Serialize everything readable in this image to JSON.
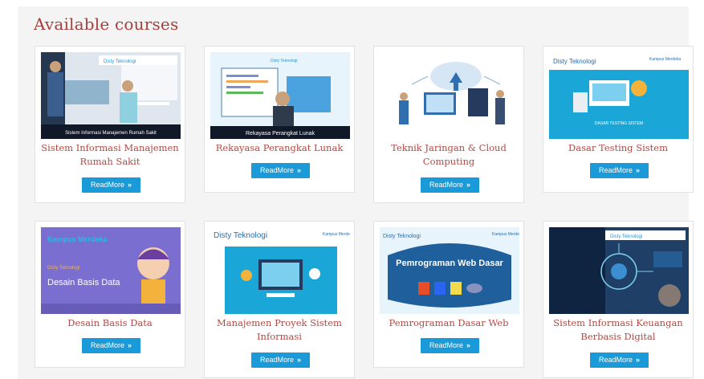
{
  "heading": "Available courses",
  "readmore_label": "ReadMore",
  "readmore_chevron": "»",
  "colors": {
    "heading": "#a5403c",
    "title": "#b04a45",
    "button": "#1a9ad8"
  },
  "courses": [
    {
      "title": "Sistem Informasi Manajemen Rumah Sakit",
      "thumb_caption": "Sistem Informasi Manajemen Rumah Sakit",
      "brand": "Disty Teknologi"
    },
    {
      "title": "Rekayasa Perangkat Lunak",
      "thumb_caption": "Rekayasa Perangkat Lunak",
      "brand": "Disty Teknologi"
    },
    {
      "title": "Teknik Jaringan & Cloud Computing",
      "thumb_caption": "",
      "brand": ""
    },
    {
      "title": "Dasar Testing Sistem",
      "thumb_caption": "DASAR TESTING SISTEM",
      "brand": "Disty Teknologi"
    },
    {
      "title": "Desain Basis Data",
      "thumb_caption": "Desain Basis Data",
      "brand": "Disty Teknologi"
    },
    {
      "title": "Manajemen Proyek Sistem Informasi",
      "thumb_caption": "",
      "brand": "Disty Teknologi"
    },
    {
      "title": "Pemrograman Dasar Web",
      "thumb_caption": "Pemrograman Web Dasar",
      "brand": "Disty Teknologi"
    },
    {
      "title": "Sistem Informasi Keuangan Berbasis Digital",
      "thumb_caption": "",
      "brand": "Disty Teknologi"
    }
  ],
  "kampus_logo": "Kampus Merdeka"
}
